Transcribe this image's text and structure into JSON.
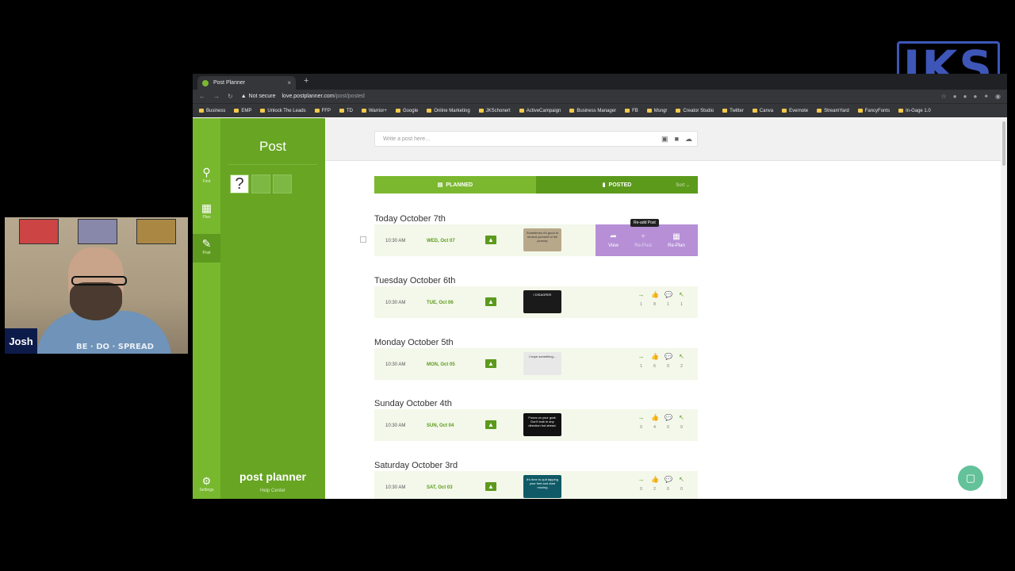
{
  "overlay": {
    "cam_name": "Josh",
    "shirt_text": "BE · DO · SPREAD",
    "logo_text": "JKS"
  },
  "browser": {
    "tab_title": "Post Planner",
    "tab_close": "×",
    "new_tab": "+",
    "security": "Not secure",
    "url_host": "love.postplanner.com",
    "url_path": "/post/posted",
    "bookmarks": [
      "Business",
      "EMP",
      "Unlock The Leads",
      "FFP",
      "TD",
      "Warrior+",
      "Google",
      "Online Marketing",
      "JKSchonert",
      "ActiveCampaign",
      "Business Manager",
      "FB",
      "Msngr",
      "Creator Studio",
      "Twitter",
      "Canva",
      "Evernote",
      "StreamYard",
      "FancyFonts",
      "In-Gage 1.0"
    ]
  },
  "nav": {
    "find": "Find",
    "plan": "Plan",
    "post": "Post",
    "settings": "Settings"
  },
  "panel": {
    "title": "Post",
    "logo": "post planner",
    "help": "Help Center"
  },
  "composer": {
    "placeholder": "Write a post here..."
  },
  "toggle": {
    "planned": "PLANNED",
    "posted": "POSTED",
    "sort": "Sort ⌄"
  },
  "hover": {
    "tooltip": "Re-add Post",
    "view": "View",
    "readd": "Re-Post",
    "replan": "Re-Plan"
  },
  "days": [
    {
      "heading": "Today October 7th",
      "time": "10:30 AM",
      "date": "WED, Oct 07",
      "thumb_text": "Sometimes it's good to remind yourself of the journey",
      "thumb_color": "#b8a88a",
      "stats": [
        "",
        "",
        "",
        ""
      ]
    },
    {
      "heading": "Tuesday October 6th",
      "time": "10:30 AM",
      "date": "TUE, Oct 06",
      "thumb_text": "I DISAGREE",
      "thumb_color": "#1a1a1a",
      "stats": [
        "1",
        "8",
        "1",
        "1"
      ]
    },
    {
      "heading": "Monday October 5th",
      "time": "10:30 AM",
      "date": "MON, Oct 05",
      "thumb_text": "I hope something...",
      "thumb_color": "#e8e8e8",
      "stats": [
        "1",
        "6",
        "0",
        "2"
      ]
    },
    {
      "heading": "Sunday October 4th",
      "time": "10:30 AM",
      "date": "SUN, Oct 04",
      "thumb_text": "Focus on your goal. Don't look in any direction but ahead.",
      "thumb_color": "#111111",
      "stats": [
        "0",
        "4",
        "0",
        "0"
      ]
    },
    {
      "heading": "Saturday October 3rd",
      "time": "10:30 AM",
      "date": "SAT, Oct 03",
      "thumb_text": "It's time to quit tapping your feet and start moving",
      "thumb_color": "#0f5a66",
      "stats": [
        "0",
        "2",
        "0",
        "0"
      ]
    }
  ]
}
